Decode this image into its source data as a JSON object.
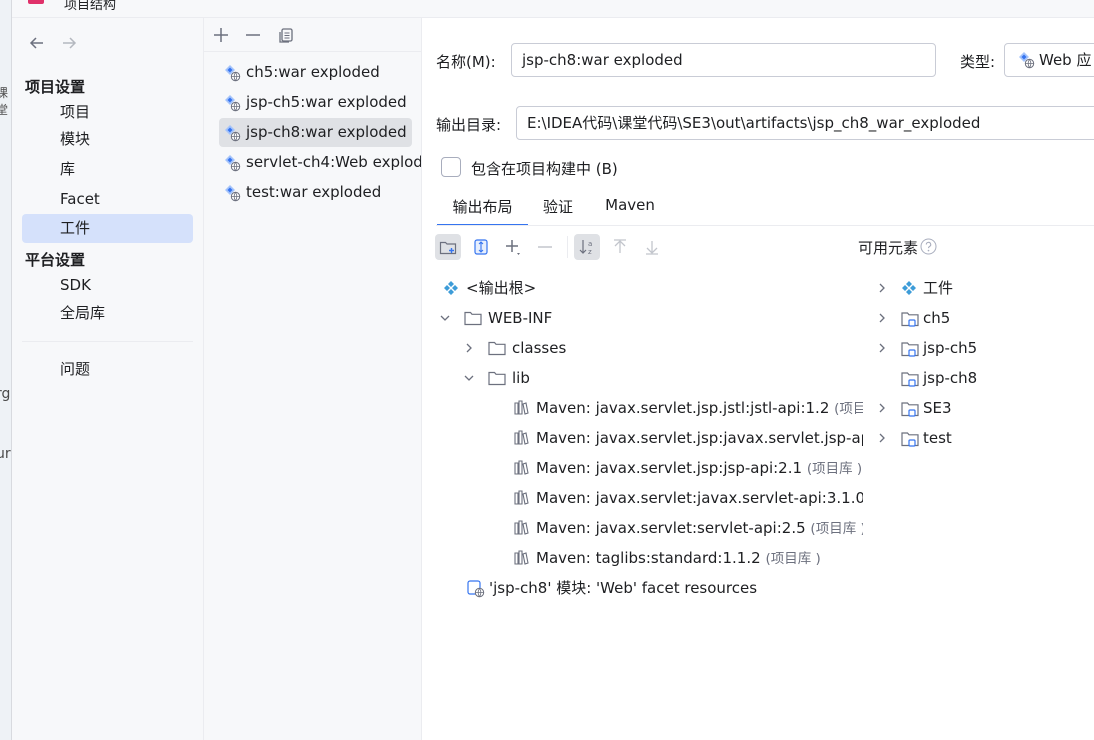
{
  "window": {
    "title": "项目结构"
  },
  "background_window": {
    "fragments": [
      "课堂",
      "rg",
      "ur"
    ]
  },
  "nav": {
    "sections": [
      {
        "title": "项目设置",
        "items": [
          "项目",
          "模块",
          "库",
          "Facet",
          "工件"
        ]
      },
      {
        "title": "平台设置",
        "items": [
          "SDK",
          "全局库"
        ]
      }
    ],
    "problems": "问题",
    "selected": "工件"
  },
  "artifacts": {
    "items": [
      "ch5:war exploded",
      "jsp-ch5:war exploded",
      "jsp-ch8:war exploded",
      "servlet-ch4:Web exploded",
      "test:war exploded"
    ],
    "selected": "jsp-ch8:war exploded"
  },
  "form": {
    "name_label": "名称(M):",
    "name_value": "jsp-ch8:war exploded",
    "type_label": "类型:",
    "type_value": "Web 应",
    "output_label": "输出目录:",
    "output_value": "E:\\IDEA代码\\课堂代码\\SE3\\out\\artifacts\\jsp_ch8_war_exploded",
    "include_label": "包含在项目构建中 (B)",
    "include_checked": false
  },
  "tabs": [
    "输出布局",
    "验证",
    "Maven"
  ],
  "selected_tab": "输出布局",
  "available_label": "可用元素",
  "output_tree": {
    "root": "<输出根>",
    "webinf": "WEB-INF",
    "classes": "classes",
    "lib": "lib",
    "libs": [
      {
        "name": "Maven: javax.servlet.jsp.jstl:jstl-api:1.2",
        "suffix": "(项目库"
      },
      {
        "name": "Maven: javax.servlet.jsp:javax.servlet.jsp-api:",
        "suffix": ""
      },
      {
        "name": "Maven: javax.servlet.jsp:jsp-api:2.1",
        "suffix": "(项目库 )"
      },
      {
        "name": "Maven: javax.servlet:javax.servlet-api:3.1.0",
        "suffix": "(项"
      },
      {
        "name": "Maven: javax.servlet:servlet-api:2.5",
        "suffix": "(项目库 )"
      },
      {
        "name": "Maven: taglibs:standard:1.1.2",
        "suffix": "(项目库 )"
      }
    ],
    "facet": "'jsp-ch8' 模块: 'Web' facet resources"
  },
  "available_tree": [
    "工件",
    "ch5",
    "jsp-ch5",
    "jsp-ch8",
    "SE3",
    "test"
  ],
  "colors": {
    "accent": "#3574f0",
    "nav_selected": "#d5e1fb",
    "list_selected": "#dfe1e5",
    "icon": "#6c707e",
    "artifact_icon": "#3574f0"
  }
}
